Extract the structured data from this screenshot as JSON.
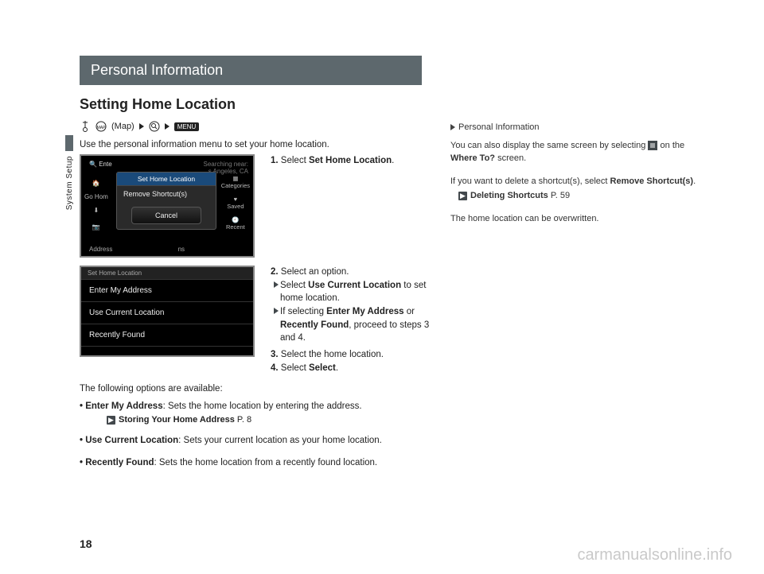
{
  "side_tab": "System Setup",
  "chapter": "Personal Information",
  "section": "Setting Home Location",
  "icon_row": {
    "map_label": "(Map)",
    "menu_chip": "MENU"
  },
  "intro": "Use the personal information menu to set your home location.",
  "screenshot1": {
    "top_left": "Ente",
    "top_right_line1": "Searching near:",
    "top_right_line2": "s  Angeles, CA",
    "left_go_home": "Go Hom",
    "cat": "Categories",
    "saved": "Saved",
    "recent": "Recent",
    "popup_title": "Set Home Location",
    "popup_item": "Remove Shortcut(s)",
    "cancel": "Cancel",
    "bottom_addr": "Address",
    "bottom_ns": "ns"
  },
  "screenshot2": {
    "titlebar": "Set Home Location",
    "row1": "Enter My Address",
    "row2": "Use Current Location",
    "row3": "Recently Found"
  },
  "step1": {
    "num": "1.",
    "text_a": "Select ",
    "bold": "Set Home Location",
    "tail": "."
  },
  "step2": {
    "num": "2.",
    "lead": "Select an option.",
    "sub1_a": "Select ",
    "sub1_b": "Use Current Location",
    "sub1_c": " to set home location.",
    "sub2_a": "If selecting ",
    "sub2_b": "Enter My Address",
    "sub2_c": " or ",
    "sub2_d": "Recently Found",
    "sub2_e": ", proceed to steps 3 and 4."
  },
  "step3": {
    "num": "3.",
    "text": "Select the home location."
  },
  "step4": {
    "num": "4.",
    "text_a": "Select ",
    "bold": "Select",
    "tail": "."
  },
  "opts_intro": "The following options are available:",
  "opts": {
    "o1_b": "Enter My Address",
    "o1_t": ": Sets the home location by entering the address.",
    "o1_xref_b": "Storing Your Home Address",
    "o1_xref_p": " P. 8",
    "o2_b": "Use Current Location",
    "o2_t": ": Sets your current location as your home location.",
    "o3_b": "Recently Found",
    "o3_t": ": Sets the home location from a recently found location."
  },
  "right": {
    "header": "Personal Information",
    "p1_a": "You can also display the same screen by selecting ",
    "p1_b": " on the ",
    "p1_c": "Where To?",
    "p1_d": " screen.",
    "p2_a": "If you want to delete a shortcut(s), select ",
    "p2_b": "Remove Shortcut(s)",
    "p2_c": ".",
    "p2_xref_b": "Deleting Shortcuts",
    "p2_xref_p": " P. 59",
    "p3": "The home location can be overwritten."
  },
  "page_num": "18",
  "watermark": "carmanualsonline.info"
}
